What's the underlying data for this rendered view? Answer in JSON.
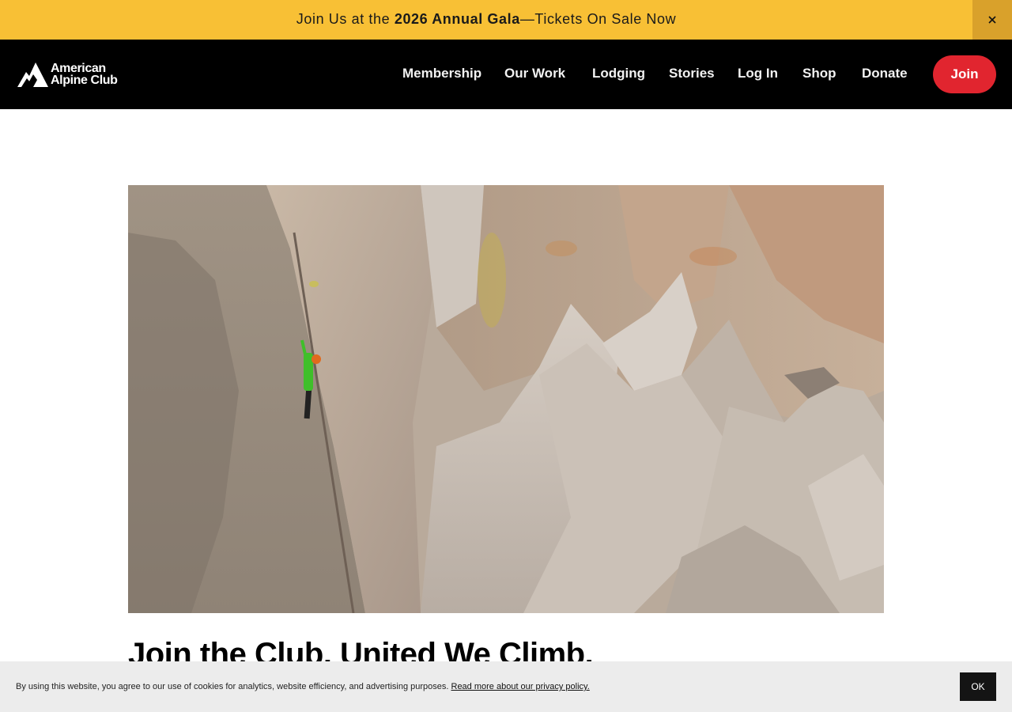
{
  "banner": {
    "prefix": "Join Us at the ",
    "highlight": "2026 Annual Gala",
    "suffix": "—Tickets On Sale Now",
    "close_icon": "close-icon",
    "background": "#f8c035"
  },
  "header": {
    "logo_line1": "American",
    "logo_line2": "Alpine Club",
    "logo_icon": "mountain-icon",
    "nav": [
      {
        "label": "Membership"
      },
      {
        "label": "Our Work"
      },
      {
        "label": "Lodging"
      },
      {
        "label": "Stories"
      },
      {
        "label": "Log In"
      },
      {
        "label": "Shop"
      },
      {
        "label": "Donate"
      }
    ],
    "join_label": "Join",
    "accent": "#e1252f"
  },
  "main": {
    "hero_alt": "Climber in green jacket and red helmet on a granite crack",
    "headline": "Join the Club. United We Climb."
  },
  "cookie": {
    "text": "By using this website, you agree to our use of cookies for analytics, website efficiency, and advertising purposes. ",
    "link": "Read more about our privacy policy.",
    "ok_label": "OK"
  }
}
